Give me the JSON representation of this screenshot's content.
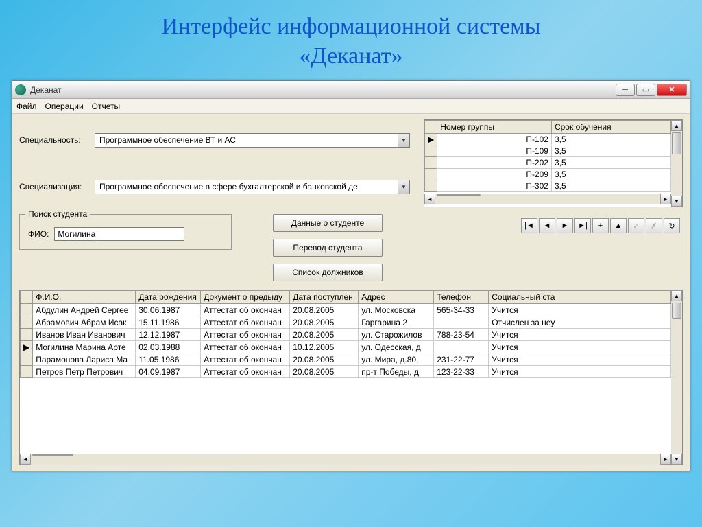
{
  "slide": {
    "title_line1": "Интерфейс информационной системы",
    "title_line2": "«Деканат»"
  },
  "window": {
    "title": "Деканат",
    "menu": {
      "file": "Файл",
      "ops": "Операции",
      "reports": "Отчеты"
    }
  },
  "filters": {
    "speciality_label": "Специальность:",
    "speciality_value": "Программное обеспечение ВТ и АС",
    "specialization_label": "Специализация:",
    "specialization_value": "Программное обеспечение в сфере бухгалтерской и банковской де"
  },
  "groups": {
    "col_group": "Номер группы",
    "col_term": "Срок обучения",
    "rows": [
      {
        "g": "П-102",
        "t": "3,5"
      },
      {
        "g": "П-109",
        "t": "3,5"
      },
      {
        "g": "П-202",
        "t": "3,5"
      },
      {
        "g": "П-209",
        "t": "3,5"
      },
      {
        "g": "П-302",
        "t": "3,5"
      }
    ]
  },
  "search": {
    "legend": "Поиск студента",
    "fio_label": "ФИО:",
    "fio_value": "Могилина"
  },
  "buttons": {
    "student_data": "Данные о студенте",
    "transfer": "Перевод студента",
    "debtors": "Список должников"
  },
  "students": {
    "cols": {
      "fio": "Ф.И.О.",
      "dob": "Дата рождения",
      "doc": "Документ о предыду",
      "enroll": "Дата поступлен",
      "addr": "Адрес",
      "phone": "Телефон",
      "status": "Социальный ста"
    },
    "rows": [
      {
        "mark": "",
        "fio": "Абдулин Андрей Сергее",
        "dob": "30.06.1987",
        "doc": "Аттестат об окончан",
        "enroll": "20.08.2005",
        "addr": "ул. Московска",
        "phone": "565-34-33",
        "status": "Учится"
      },
      {
        "mark": "",
        "fio": "Абрамович Абрам Исак",
        "dob": "15.11.1986",
        "doc": "Аттестат об окончан",
        "enroll": "20.08.2005",
        "addr": "Гаргарина 2",
        "phone": "",
        "status": "Отчислен за неу"
      },
      {
        "mark": "",
        "fio": "Иванов Иван Иванович",
        "dob": "12.12.1987",
        "doc": "Аттестат об окончан",
        "enroll": "20.08.2005",
        "addr": "ул. Старожилов",
        "phone": "788-23-54",
        "status": "Учится"
      },
      {
        "mark": "▶",
        "fio": "Могилина Марина Арте",
        "dob": "02.03.1988",
        "doc": "Аттестат об окончан",
        "enroll": "10.12.2005",
        "addr": "ул. Одесская, д",
        "phone": "",
        "status": "Учится"
      },
      {
        "mark": "",
        "fio": "Парамонова Лариса Ма",
        "dob": "11.05.1986",
        "doc": "Аттестат об окончан",
        "enroll": "20.08.2005",
        "addr": "ул. Мира, д.80,",
        "phone": "231-22-77",
        "status": "Учится"
      },
      {
        "mark": "",
        "fio": "Петров Петр Петрович",
        "dob": "04.09.1987",
        "doc": "Аттестат об окончан",
        "enroll": "20.08.2005",
        "addr": "пр-т Победы, д",
        "phone": "123-22-33",
        "status": "Учится"
      }
    ]
  }
}
